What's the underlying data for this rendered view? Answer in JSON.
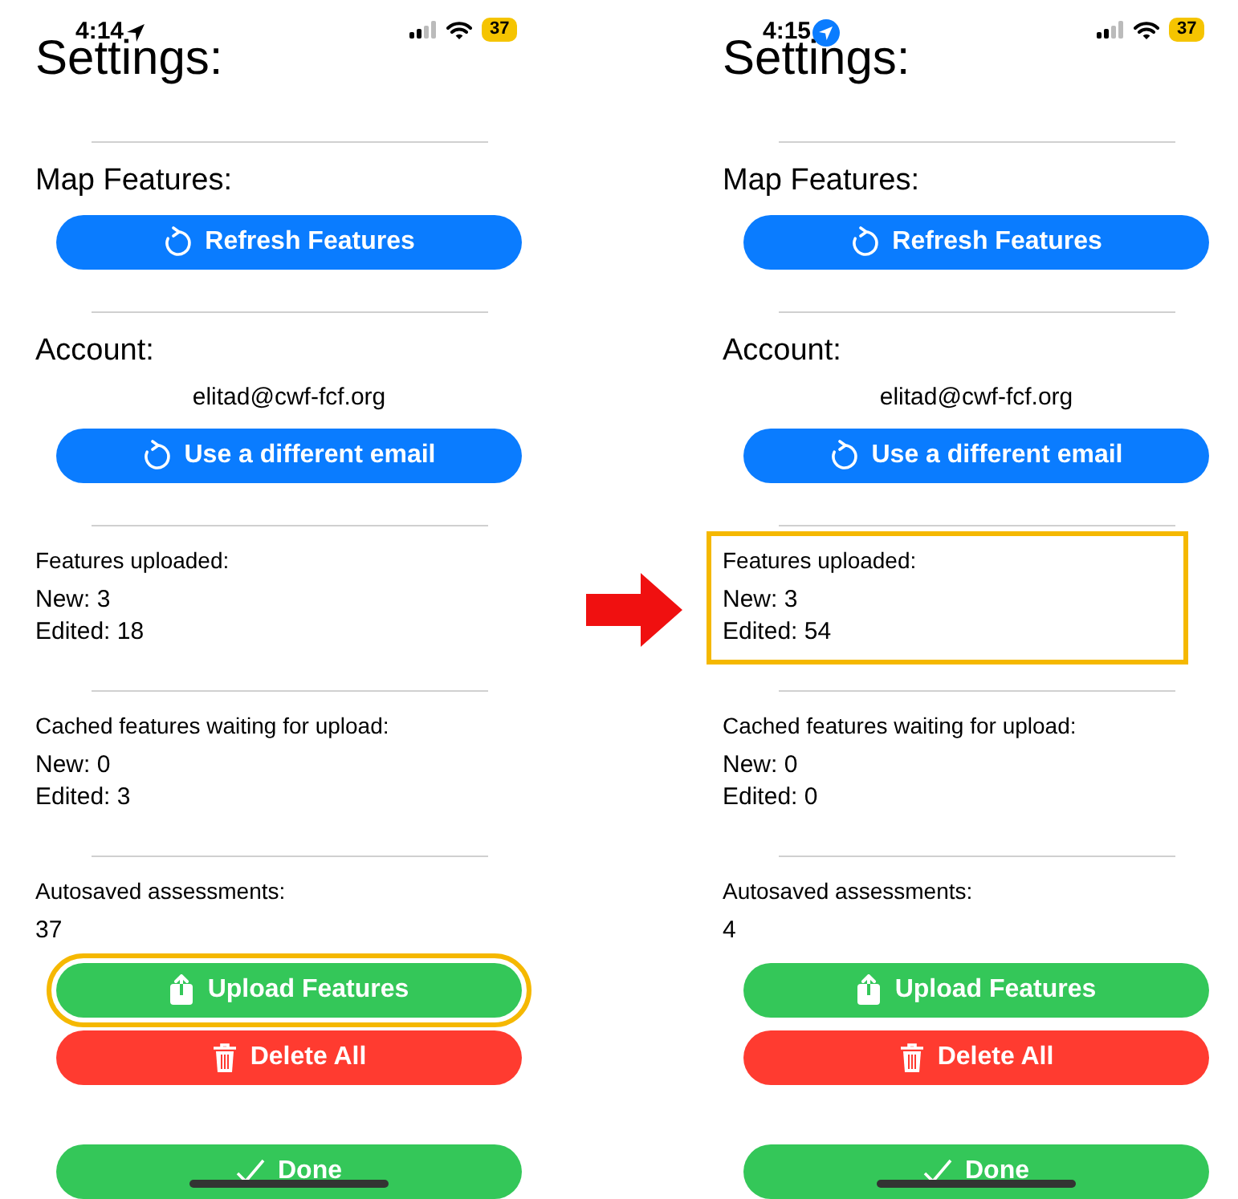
{
  "screens": [
    {
      "status_bar": {
        "time": "4:14",
        "battery": "37"
      },
      "title": "Settings:",
      "items": [
        {
          "kind": "divider"
        },
        {
          "kind": "heading",
          "text": "Map Features:"
        },
        {
          "kind": "refresh",
          "label": "Refresh Features",
          "highlighted": false
        },
        {
          "kind": "divider"
        },
        {
          "kind": "heading",
          "text": "Account:"
        },
        {
          "kind": "email",
          "text": "elitad@cwf-fcf.org"
        },
        {
          "kind": "refresh",
          "label": "Use a different email",
          "highlighted": false
        },
        {
          "kind": "divider"
        },
        {
          "kind": "group",
          "label": "Features uploaded:",
          "lines": [
            "New: 3",
            "Edited: 18"
          ],
          "highlighted": false
        },
        {
          "kind": "divider"
        },
        {
          "kind": "group",
          "label": "Cached features waiting for upload:",
          "lines": [
            "New: 0",
            "Edited: 3"
          ],
          "highlighted": false
        },
        {
          "kind": "divider"
        },
        {
          "kind": "group",
          "label": "Autosaved assessments:",
          "lines": [
            "37"
          ],
          "highlighted": false
        },
        {
          "kind": "upload",
          "label": "Upload Features",
          "highlighted": true
        },
        {
          "kind": "delete",
          "label": "Delete All",
          "highlighted": false
        },
        {
          "kind": "done",
          "label": "Done",
          "highlighted": false
        }
      ]
    },
    {
      "status_bar": {
        "time": "4:15",
        "battery": "37"
      },
      "title": "Settings:",
      "items": [
        {
          "kind": "divider"
        },
        {
          "kind": "heading",
          "text": "Map Features:"
        },
        {
          "kind": "refresh",
          "label": "Refresh Features",
          "highlighted": false
        },
        {
          "kind": "divider"
        },
        {
          "kind": "heading",
          "text": "Account:"
        },
        {
          "kind": "email",
          "text": "elitad@cwf-fcf.org"
        },
        {
          "kind": "refresh",
          "label": "Use a different email",
          "highlighted": false
        },
        {
          "kind": "divider"
        },
        {
          "kind": "group",
          "label": "Features uploaded:",
          "lines": [
            "New: 3",
            "Edited: 54"
          ],
          "highlighted": true
        },
        {
          "kind": "divider"
        },
        {
          "kind": "group",
          "label": "Cached features waiting for upload:",
          "lines": [
            "New: 0",
            "Edited: 0"
          ],
          "highlighted": false
        },
        {
          "kind": "divider"
        },
        {
          "kind": "group",
          "label": "Autosaved assessments:",
          "lines": [
            "4"
          ],
          "highlighted": false
        },
        {
          "kind": "upload",
          "label": "Upload Features",
          "highlighted": false
        },
        {
          "kind": "delete",
          "label": "Delete All",
          "highlighted": false
        },
        {
          "kind": "done",
          "label": "Done",
          "highlighted": false
        }
      ]
    }
  ]
}
